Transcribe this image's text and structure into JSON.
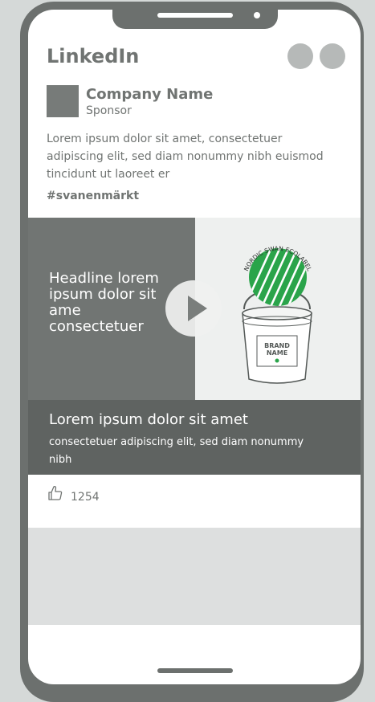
{
  "app": {
    "title": "LinkedIn"
  },
  "post": {
    "company_name": "Company Name",
    "sponsor_label": "Sponsor",
    "body_text": "Lorem ipsum dolor sit amet, consectetuer adipiscing elit, sed diam nonummy nibh euismod tincidunt ut laoreet er",
    "hashtag": "#svanenmärkt"
  },
  "video": {
    "headline": "Headline lorem ipsum dolor sit ame consectetuer",
    "ecolabel_text": "NORDIC SWAN ECOLABEL",
    "brand_name_line1": "BRAND",
    "brand_name_line2": "NAME"
  },
  "caption": {
    "title": "Lorem ipsum dolor sit amet",
    "subtitle": "consectetuer adipiscing elit, sed diam nonummy nibh"
  },
  "reactions": {
    "like_count": "1254"
  },
  "icons": {
    "play": "play-icon",
    "like": "thumbs-up-icon",
    "ecolabel": "nordic-swan-ecolabel-icon"
  },
  "colors": {
    "phone_frame": "#6c706e",
    "ecolabel_green": "#2aa44a",
    "caption_bg": "#5f6361"
  }
}
